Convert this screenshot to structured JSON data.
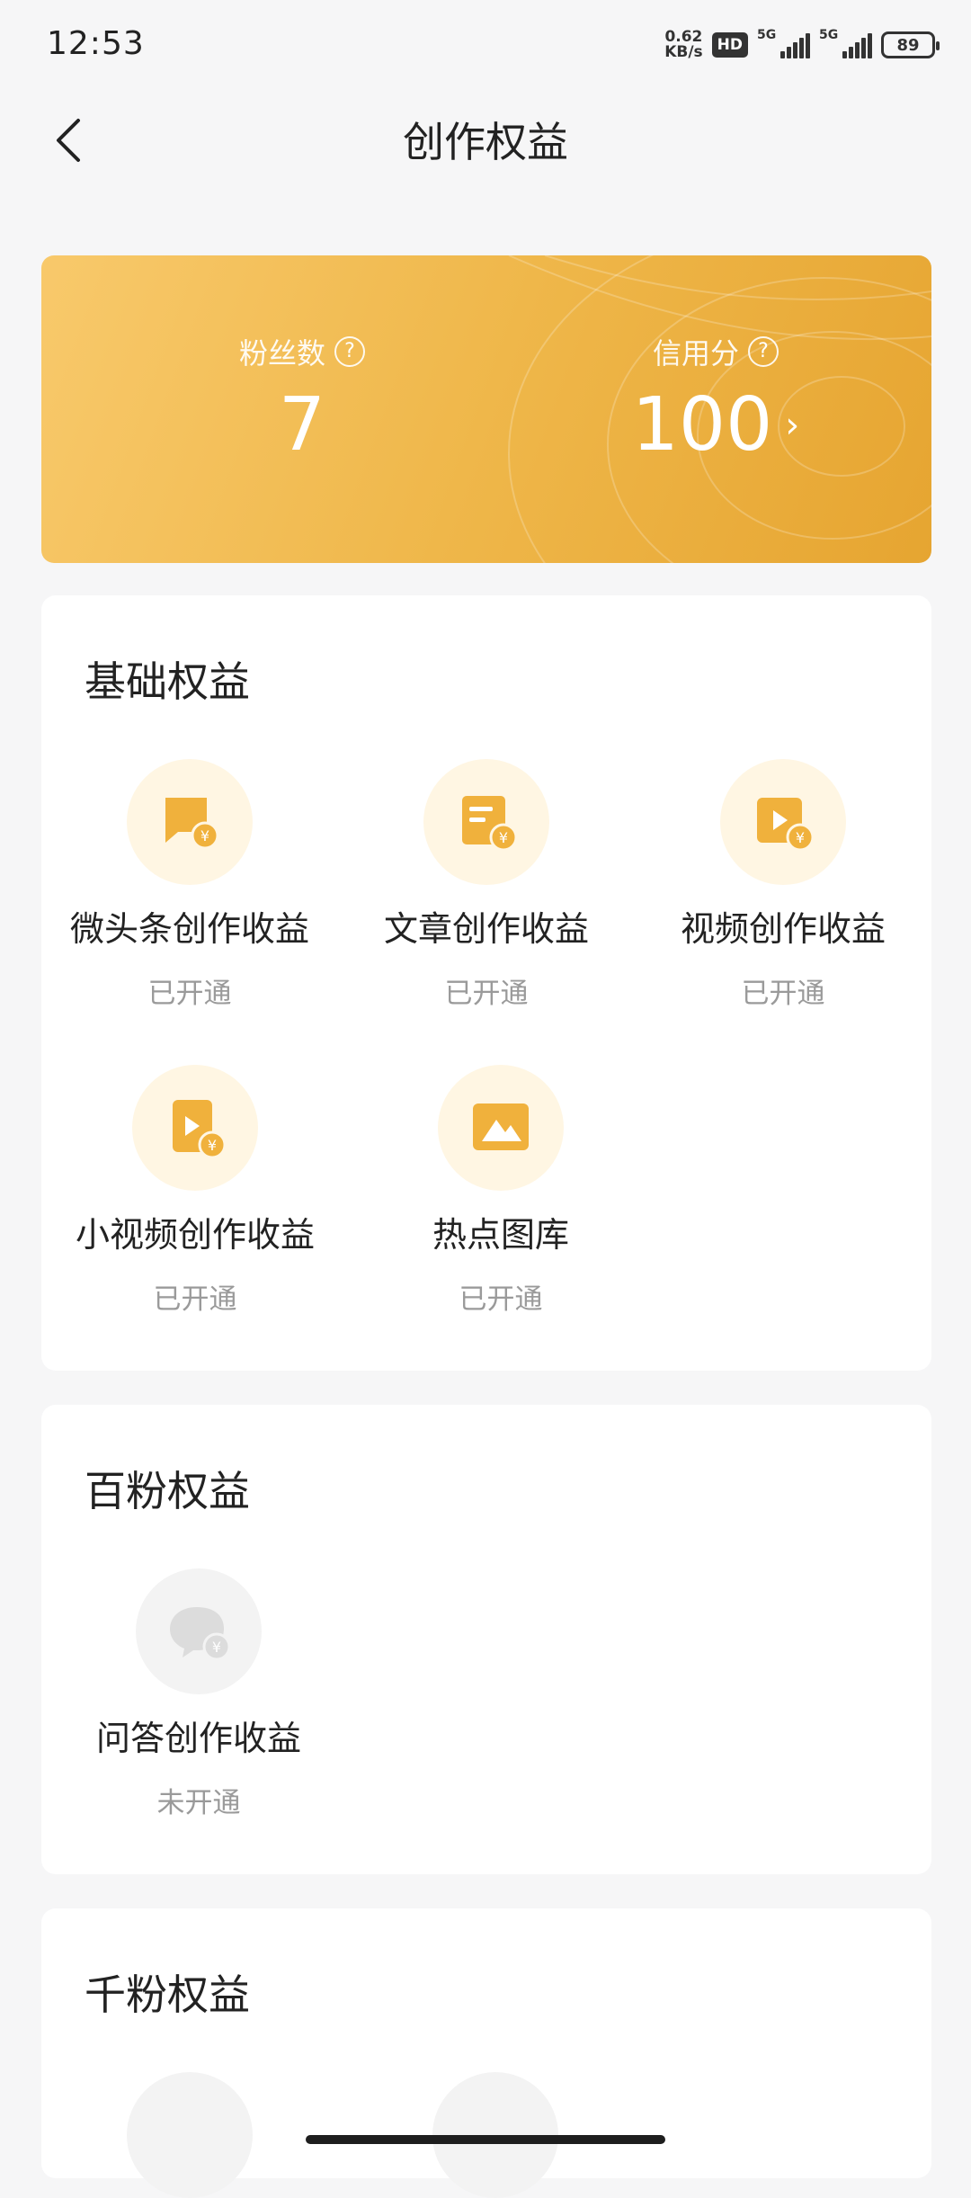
{
  "status_bar": {
    "time": "12:53",
    "net_speed_value": "0.62",
    "net_speed_unit": "KB/s",
    "hd_label": "HD",
    "signal_label_1": "5G",
    "signal_label_2": "5G",
    "battery": "89"
  },
  "header": {
    "title": "创作权益",
    "back_icon": "chevron-left-icon"
  },
  "stats": {
    "fans_label": "粉丝数",
    "fans_value": "7",
    "credit_label": "信用分",
    "credit_value": "100",
    "help_glyph": "?",
    "chevron_glyph": "›",
    "card_colors": [
      "#f8c96b",
      "#e6a531"
    ]
  },
  "sections": {
    "basic": {
      "title": "基础权益",
      "items": [
        {
          "name": "微头条创作收益",
          "status": "已开通",
          "icon": "chat-bubble-yen-icon"
        },
        {
          "name": "文章创作收益",
          "status": "已开通",
          "icon": "article-yen-icon"
        },
        {
          "name": "视频创作收益",
          "status": "已开通",
          "icon": "video-yen-icon"
        },
        {
          "name": "小视频创作收益",
          "status": "已开通",
          "icon": "short-video-yen-icon"
        },
        {
          "name": "热点图库",
          "status": "已开通",
          "icon": "image-gallery-icon"
        }
      ]
    },
    "hundred": {
      "title": "百粉权益",
      "items": [
        {
          "name": "问答创作收益",
          "status": "未开通",
          "icon": "qa-bubble-yen-icon"
        }
      ]
    },
    "thousand": {
      "title": "千粉权益"
    }
  },
  "colors": {
    "accent": "#f0b23e",
    "icon_bg_on": "#fff6e3",
    "icon_bg_off": "#f3f3f3",
    "page_bg": "#f6f6f7"
  }
}
